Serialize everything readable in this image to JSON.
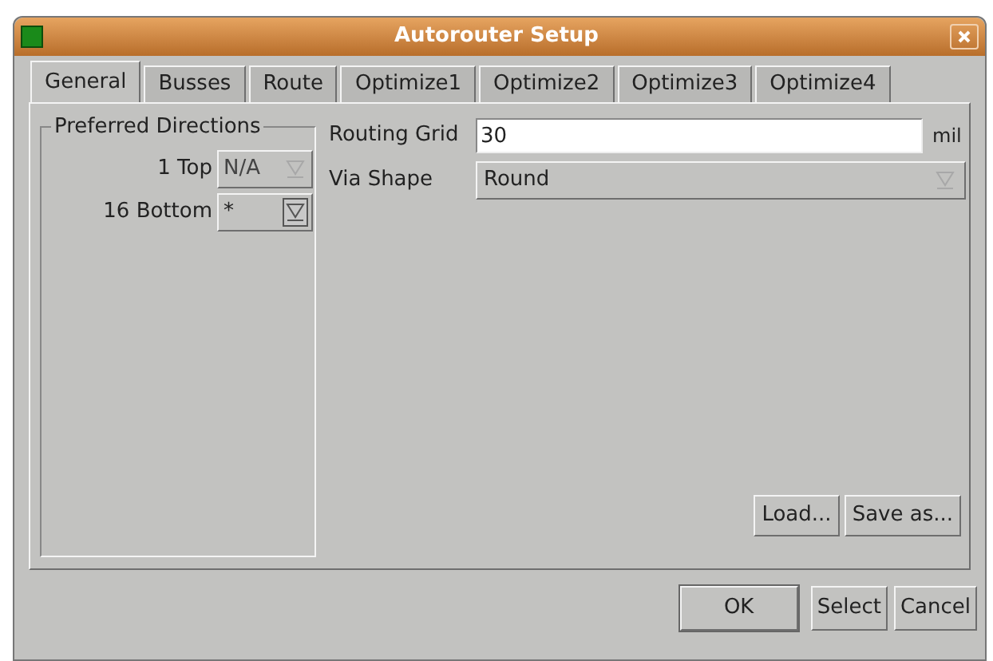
{
  "window": {
    "title": "Autorouter Setup"
  },
  "tabs": [
    {
      "label": "General",
      "selected": true
    },
    {
      "label": "Busses",
      "selected": false
    },
    {
      "label": "Route",
      "selected": false
    },
    {
      "label": "Optimize1",
      "selected": false
    },
    {
      "label": "Optimize2",
      "selected": false
    },
    {
      "label": "Optimize3",
      "selected": false
    },
    {
      "label": "Optimize4",
      "selected": false
    }
  ],
  "preferred_directions": {
    "title": "Preferred Directions",
    "layers": [
      {
        "label": "1 Top",
        "value": "N/A",
        "disabled": true
      },
      {
        "label": "16 Bottom",
        "value": "*",
        "disabled": false
      }
    ]
  },
  "routing_grid": {
    "label": "Routing Grid",
    "value": "30",
    "unit": "mil"
  },
  "via_shape": {
    "label": "Via Shape",
    "value": "Round"
  },
  "panel_buttons": [
    "Load...",
    "Save as..."
  ],
  "buttons": [
    {
      "label": "OK",
      "default": true
    },
    {
      "label": "Select",
      "default": false
    },
    {
      "label": "Cancel",
      "default": false
    }
  ]
}
